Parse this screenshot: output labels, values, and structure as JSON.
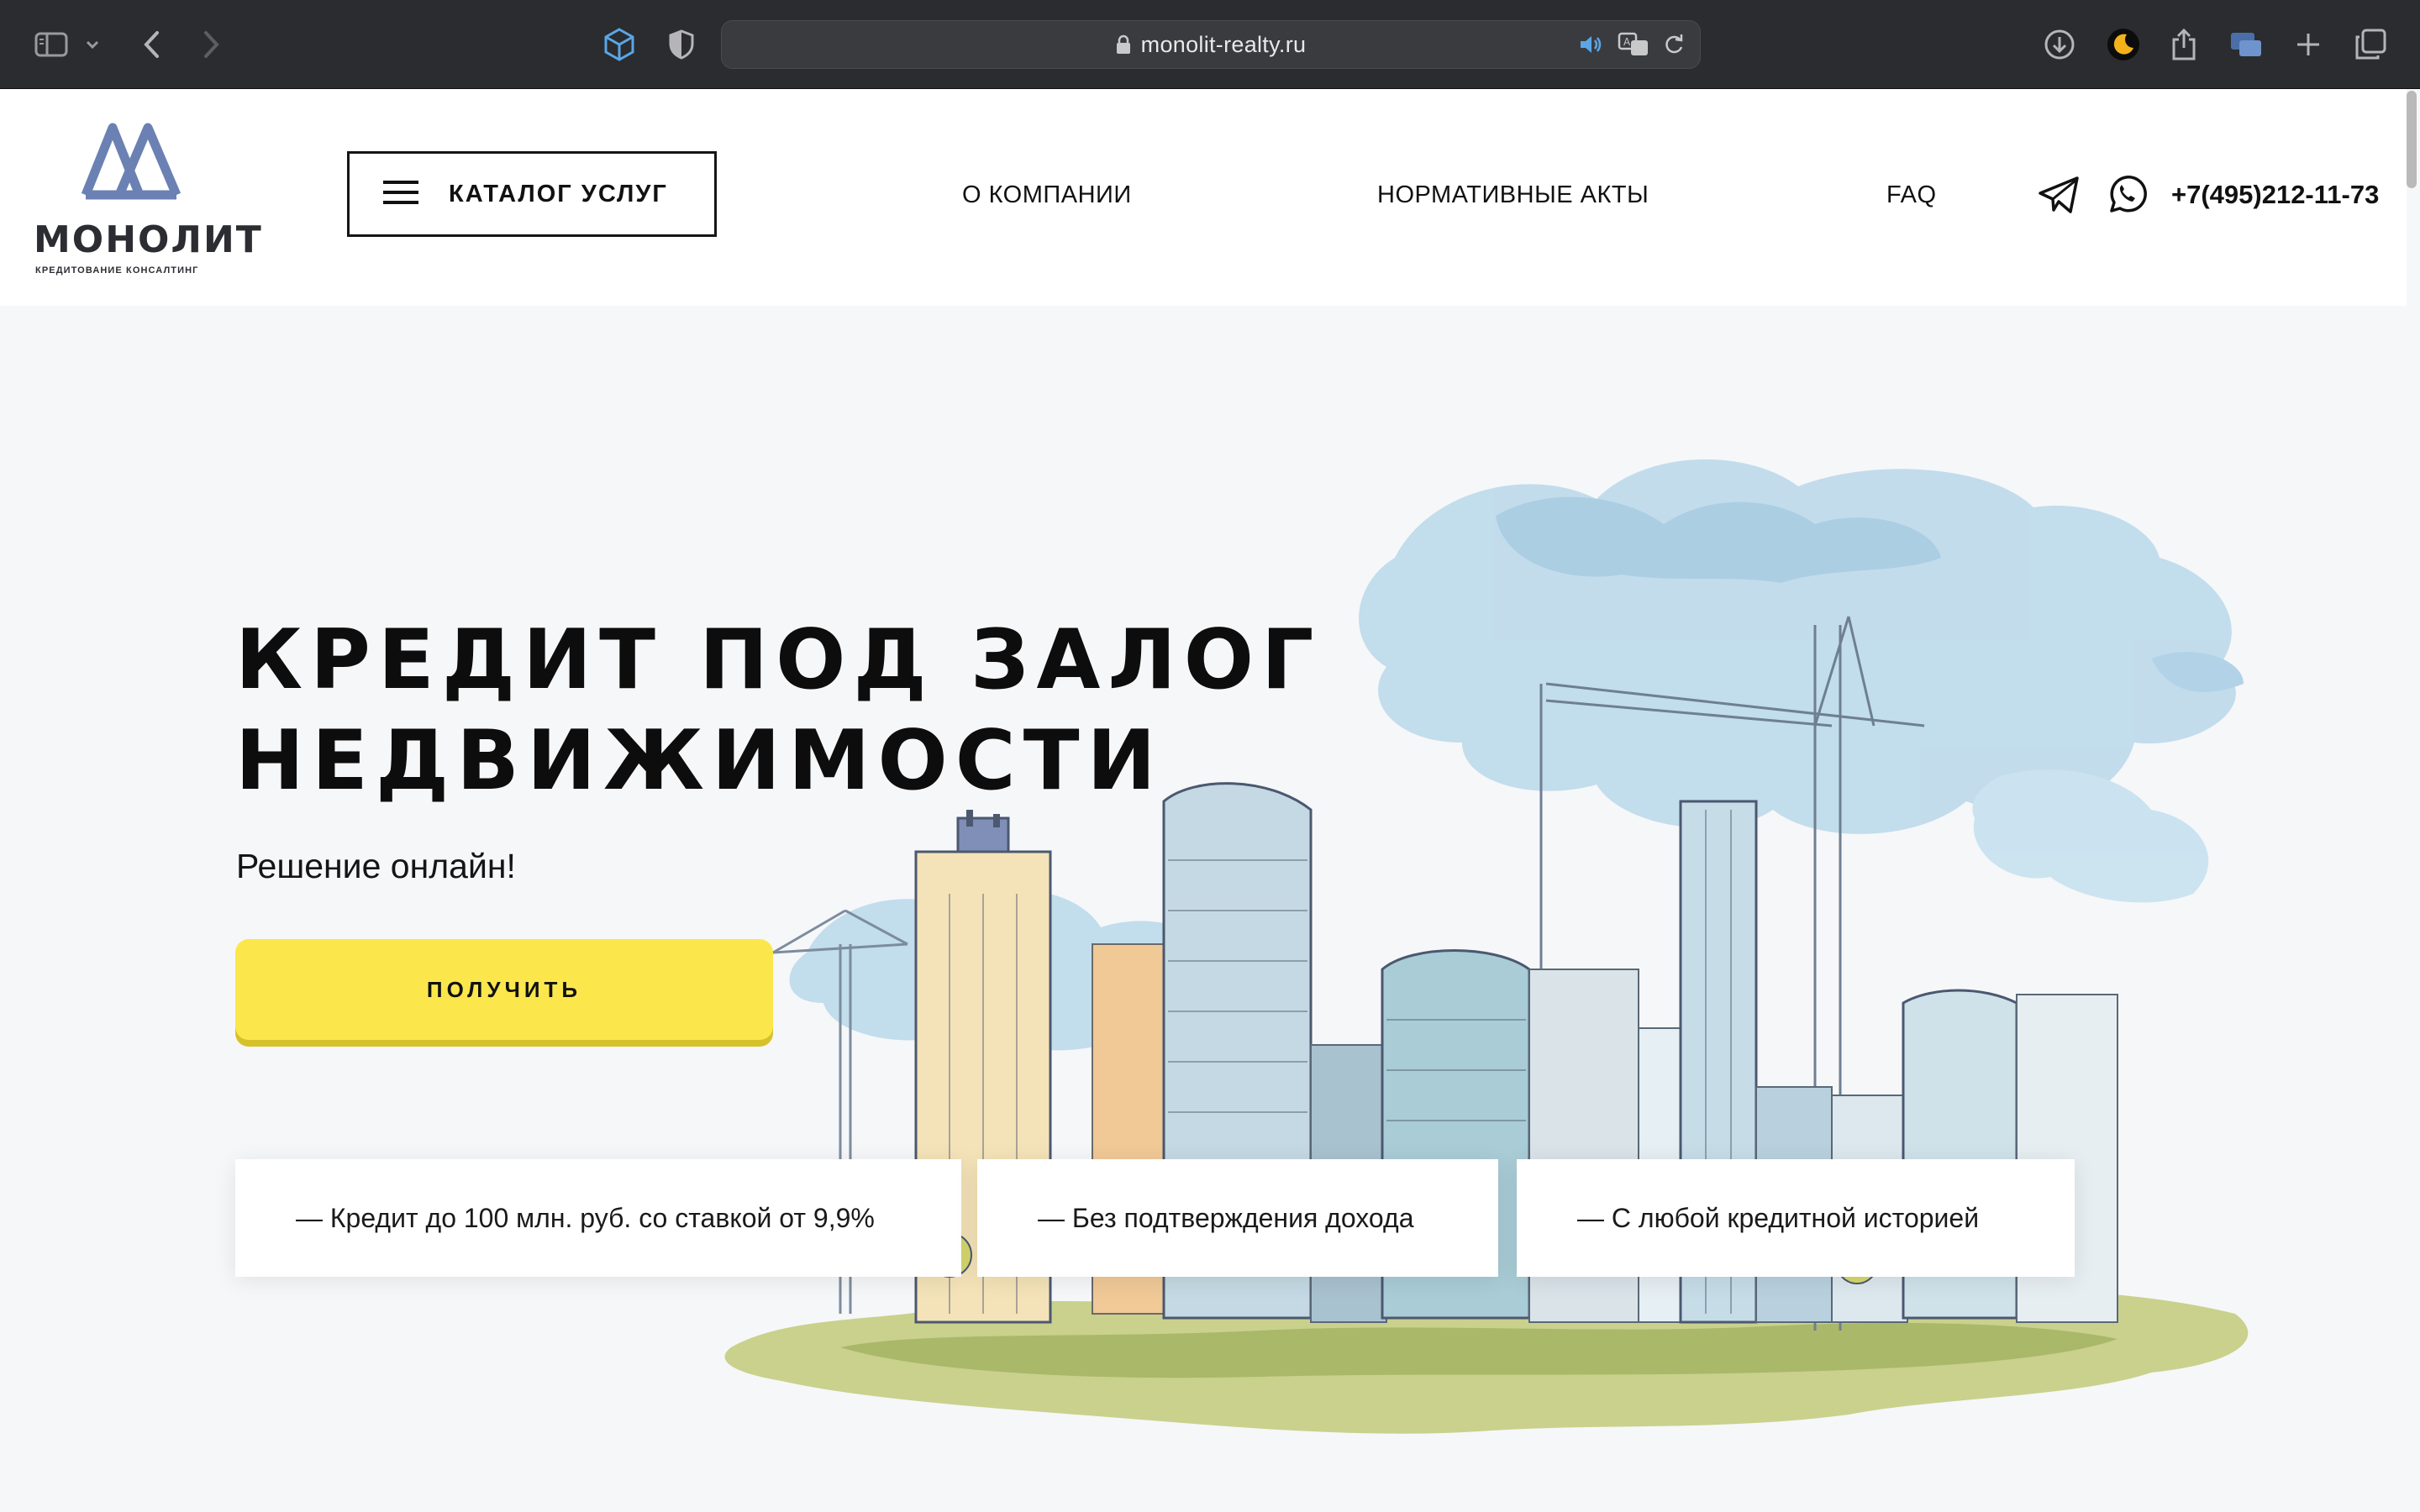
{
  "browser": {
    "url": "monolit-realty.ru",
    "icons": [
      "sidebar-icon",
      "chevron-down-icon",
      "back-icon",
      "forward-icon",
      "cube-icon",
      "shield-icon",
      "lock-icon",
      "speaker-icon",
      "translate-icon",
      "reload-icon",
      "download-icon",
      "dark-mode-icon",
      "share-icon",
      "tab-overview-icon",
      "new-tab-icon",
      "tabs-icon"
    ]
  },
  "header": {
    "logo_word": "МОНОЛИТ",
    "logo_tagline": "КРЕДИТОВАНИЕ КОНСАЛТИНГ",
    "catalog_label": "КАТАЛОГ УСЛУГ",
    "nav": [
      "О КОМПАНИИ",
      "НОРМАТИВНЫЕ АКТЫ",
      "FAQ"
    ],
    "phone": "+7(495)212-11-73"
  },
  "hero": {
    "title_line1": "КРЕДИТ ПОД ЗАЛОГ",
    "title_line2": "НЕДВИЖИМОСТИ",
    "subtitle": "Решение онлайн!",
    "cta_label": "ПОЛУЧИТЬ",
    "features": [
      "— Кредит до 100 млн. руб. со ставкой от 9,9%",
      "— Без подтверждения дохода",
      "— С любой кредитной историей"
    ]
  },
  "colors": {
    "accent_yellow": "#fbe74c",
    "logo_blue": "#6b81b3",
    "text_dark": "#111111",
    "chrome_bg": "#2b2c2f"
  }
}
